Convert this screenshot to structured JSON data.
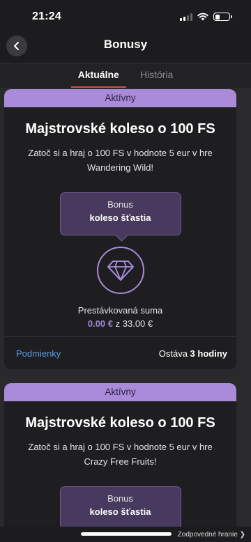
{
  "status": {
    "time": "21:24"
  },
  "header": {
    "title": "Bonusy"
  },
  "tabs": [
    {
      "label": "Aktuálne"
    },
    {
      "label": "História"
    }
  ],
  "cards": [
    {
      "badge": "Aktívny",
      "title": "Majstrovské koleso o 100 FS",
      "description": "Zatoč si a hraj o 100 FS v hodnote 5 eur v hre Wandering Wild!",
      "bonus_label": "Bonus",
      "bonus_value": "koleso šťastia",
      "wager_label": "Prestávkovaná suma",
      "wager_current": "0.00 €",
      "wager_total": "z 33.00 €",
      "terms_link": "Podmienky",
      "remaining_prefix": "Ostáva",
      "remaining_value": "3 hodiny"
    },
    {
      "badge": "Aktívny",
      "title": "Majstrovské koleso o 100 FS",
      "description": "Zatoč si a hraj o 100 FS v hodnote 5 eur v hre Crazy Free Fruits!",
      "bonus_label": "Bonus",
      "bonus_value": "koleso šťastia"
    }
  ],
  "footer": {
    "responsible_gaming": "Zodpovedné hranie ❯"
  },
  "colors": {
    "accent_purple": "#a98bd9",
    "tab_underline": "#d94a3d",
    "link_blue": "#5b9be0"
  },
  "icons": {
    "back": "chevron-left-icon",
    "diamond": "diamond-icon",
    "wifi": "wifi-icon",
    "signal": "signal-icon",
    "battery": "battery-icon"
  }
}
